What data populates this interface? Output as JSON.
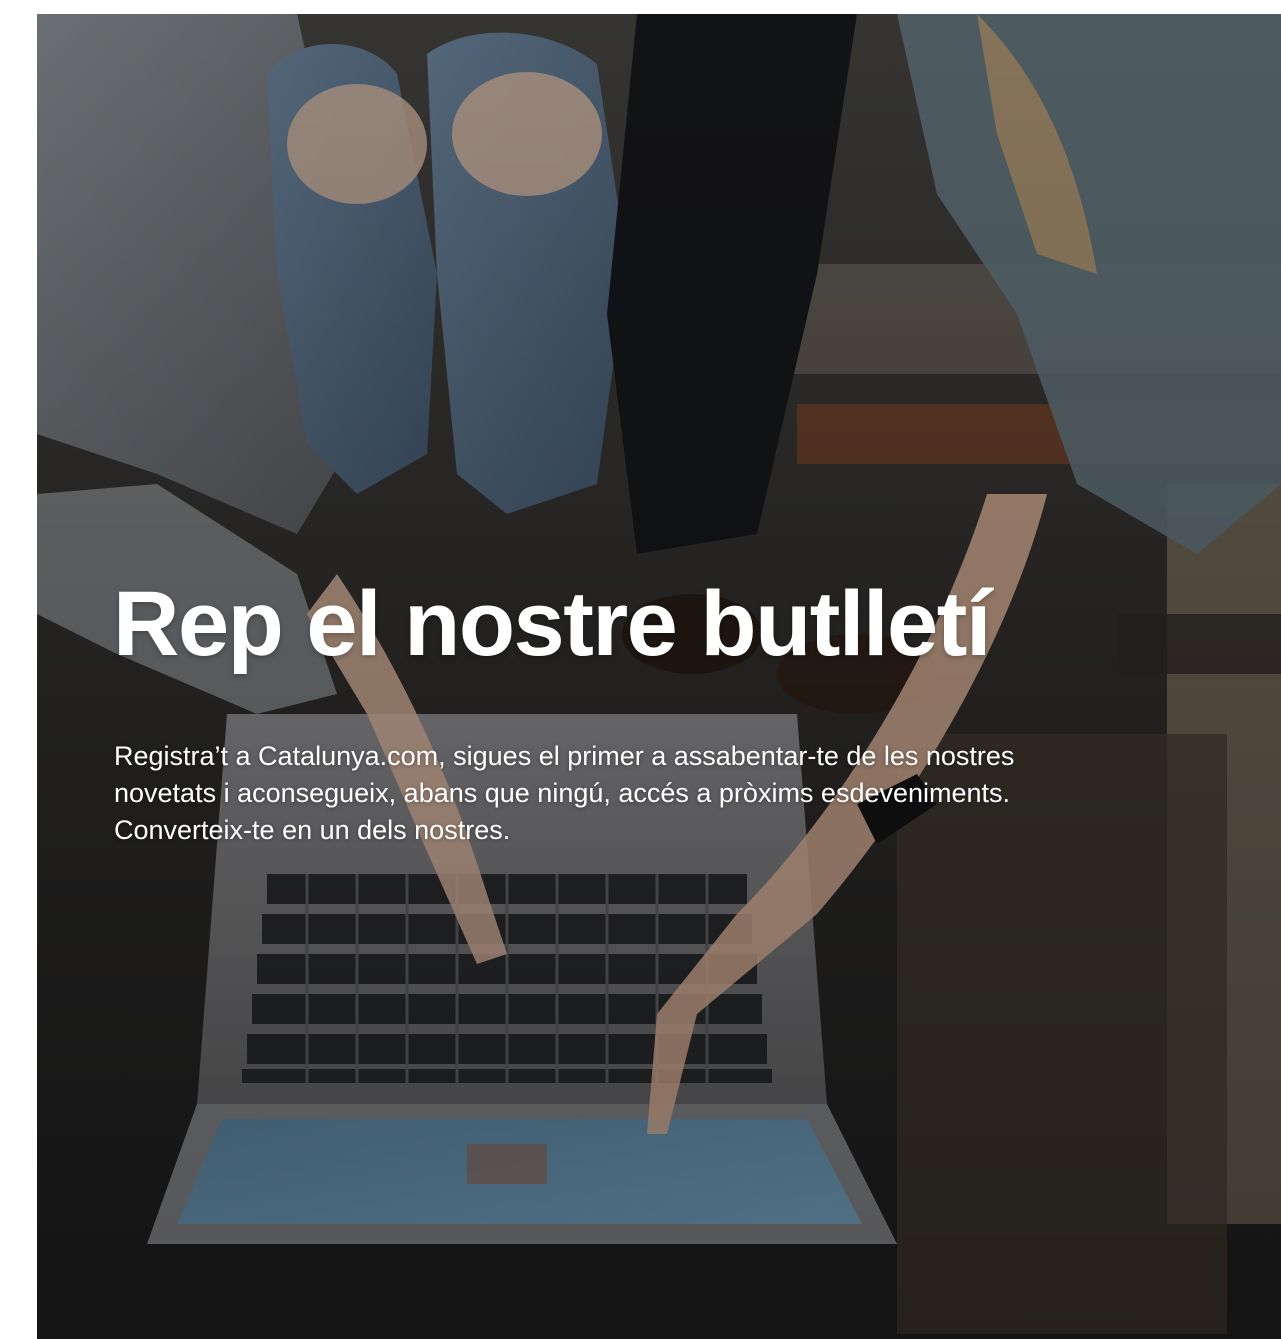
{
  "hero": {
    "title": "Rep el nostre butlletí",
    "description": "Registra’t a Catalunya.com, sigues el primer a assabentar-te de les nostres novetats i aconsegueix, abans que ningú, accés a pròxims esdeveniments. Converteix-te en un dels nostres."
  }
}
